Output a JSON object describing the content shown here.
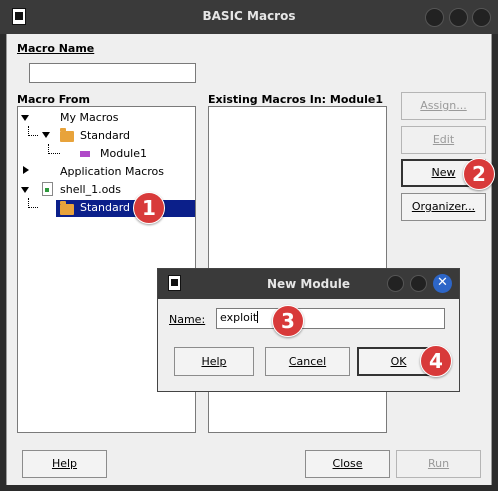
{
  "main_window": {
    "title": "BASIC Macros",
    "macro_name_label": "Macro Name",
    "macro_name_value": "",
    "macro_from_label": "Macro From",
    "existing_macros_label": "Existing Macros In: Module1",
    "tree": {
      "my_macros": "My Macros",
      "standard_1": "Standard",
      "module1": "Module1",
      "application_macros": "Application Macros",
      "document": "shell_1.ods",
      "standard_2": "Standard"
    },
    "buttons": {
      "assign": "Assign...",
      "edit": "Edit",
      "new": "New",
      "organizer": "Organizer...",
      "help": "Help",
      "close": "Close",
      "run": "Run"
    }
  },
  "dialog": {
    "title": "New Module",
    "name_label": "Name:",
    "name_value": "exploit",
    "close_glyph": "✕",
    "buttons": {
      "help": "Help",
      "cancel": "Cancel",
      "ok": "OK"
    }
  },
  "annotations": [
    "1",
    "2",
    "3",
    "4"
  ],
  "colors": {
    "selection": "#0b1f8a",
    "badge": "#d83a3a",
    "folder": "#e8a33b",
    "close_button": "#2d66c8"
  }
}
